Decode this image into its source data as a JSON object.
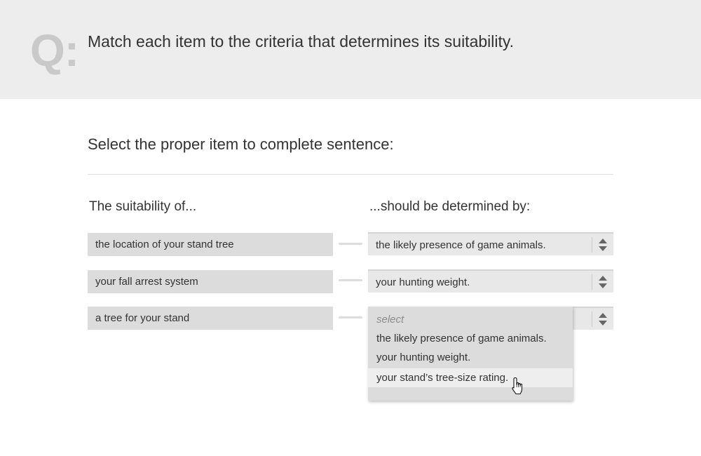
{
  "question": {
    "prefix": "Q:",
    "text": "Match each item to the criteria that determines its suitability."
  },
  "instruction": "Select the proper item to complete sentence:",
  "columns": {
    "left_header": "The suitability of...",
    "right_header": "...should be determined by:"
  },
  "rows": [
    {
      "item": "the location of your stand tree",
      "selected": "the likely presence of game animals."
    },
    {
      "item": "your fall arrest system",
      "selected": "your hunting weight."
    },
    {
      "item": "a tree for your stand",
      "selected": ""
    }
  ],
  "dropdown": {
    "placeholder": "select",
    "options": [
      "the likely presence of game animals.",
      "your hunting weight.",
      "your stand’s tree-size rating."
    ],
    "hovered_index": 2
  },
  "colors": {
    "banner_bg": "#ededed",
    "q_mark": "#c9c9c9",
    "item_bg": "#dcdcdc",
    "select_bg": "#e8e8e8",
    "text": "#333333"
  },
  "icons": {
    "spinner": "up-down-arrows-icon",
    "cursor": "hand-pointer-icon"
  }
}
